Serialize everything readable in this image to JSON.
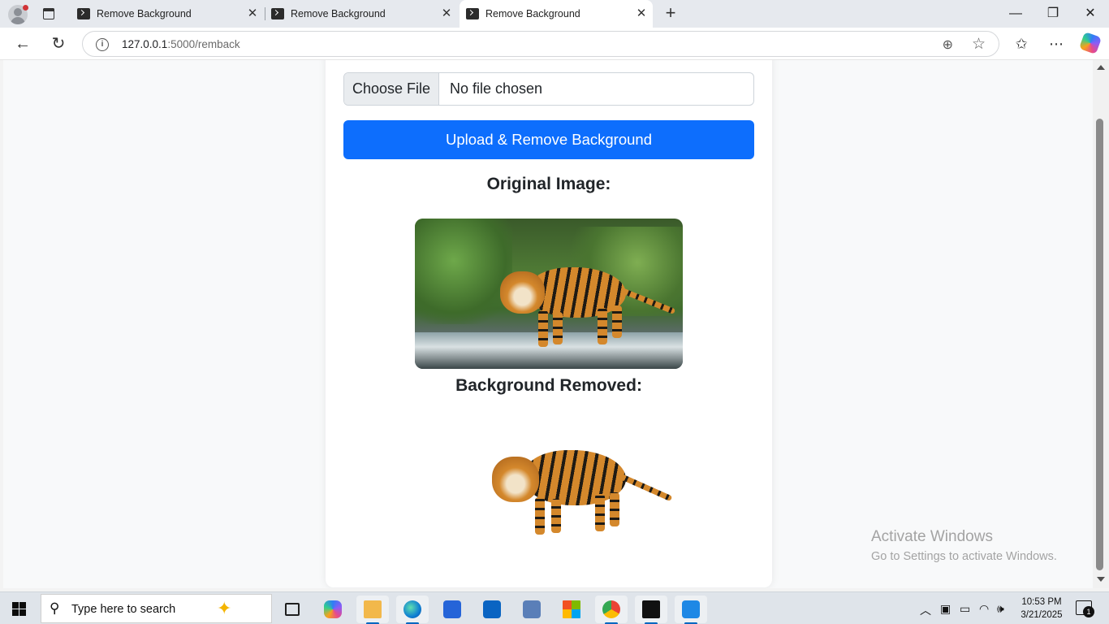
{
  "browser": {
    "tabs": [
      {
        "title": "Remove Background",
        "active": false
      },
      {
        "title": "Remove Background",
        "active": false
      },
      {
        "title": "Remove Background",
        "active": true
      }
    ],
    "url": {
      "host": "127.0.0.1",
      "path": ":5000/remback"
    }
  },
  "page": {
    "file_input": {
      "button_label": "Choose File",
      "status": "No file chosen"
    },
    "upload_button": "Upload & Remove Background",
    "original_heading": "Original Image:",
    "removed_heading": "Background Removed:"
  },
  "watermark": {
    "line1": "Activate Windows",
    "line2": "Go to Settings to activate Windows."
  },
  "taskbar": {
    "search_placeholder": "Type here to search",
    "clock": {
      "time": "10:53 PM",
      "date": "3/21/2025"
    },
    "notification_count": "1",
    "apps": [
      {
        "name": "task-view",
        "color": "#1f1f1f"
      },
      {
        "name": "copilot",
        "color": "#8c5cf6"
      },
      {
        "name": "file-explorer",
        "color": "#f2b84b"
      },
      {
        "name": "edge",
        "color": "#0f7fd3"
      },
      {
        "name": "microsoft-store",
        "color": "#2564d8"
      },
      {
        "name": "outlook",
        "color": "#0a64c2"
      },
      {
        "name": "control-panel",
        "color": "#5a7fb8"
      },
      {
        "name": "windows-tiles",
        "color": "#e8452b"
      },
      {
        "name": "chrome",
        "color": "#2ea44f"
      },
      {
        "name": "terminal",
        "color": "#111111"
      },
      {
        "name": "vs-code",
        "color": "#1e88e5"
      }
    ]
  }
}
